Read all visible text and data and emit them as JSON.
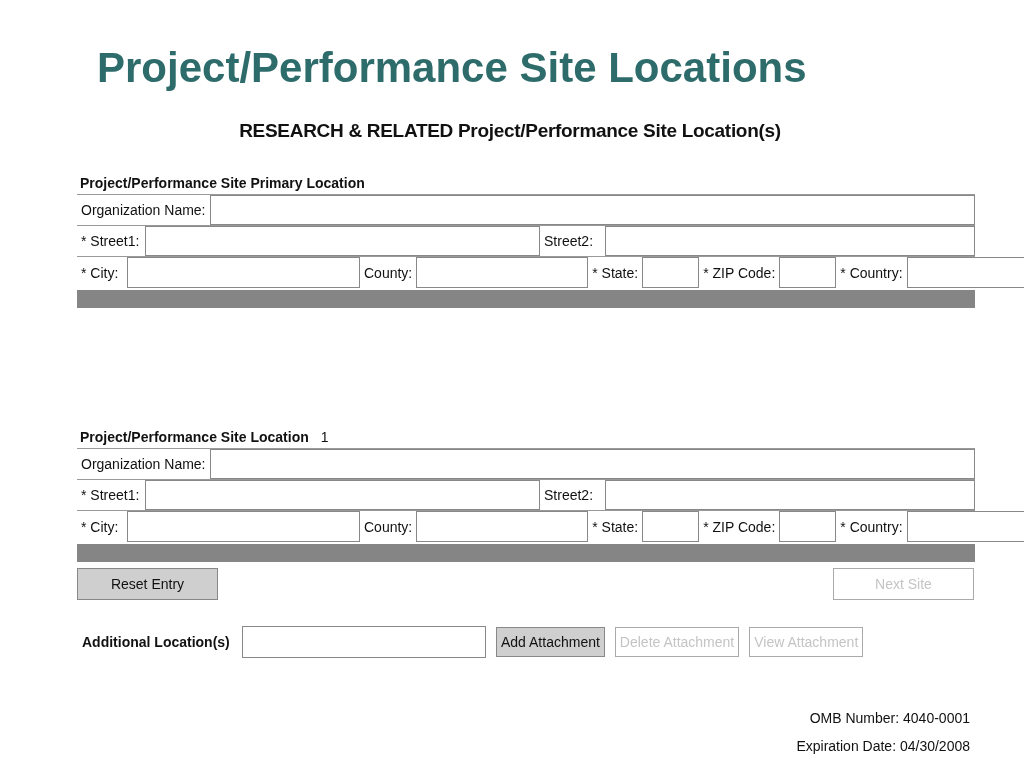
{
  "slide_title": "Project/Performance Site Locations",
  "form_title": "RESEARCH & RELATED Project/Performance Site Location(s)",
  "sections": [
    {
      "heading": "Project/Performance Site Primary Location",
      "rows": [
        [
          {
            "label": "Organization Name:"
          }
        ],
        [
          {
            "label": "* Street1:"
          },
          {
            "label": "Street2:"
          }
        ],
        [
          {
            "label": "* City:"
          },
          {
            "label": "County:"
          },
          {
            "label": "* State:"
          },
          {
            "label": "* ZIP Code:"
          },
          {
            "label": "* Country:"
          }
        ]
      ]
    },
    {
      "heading": "Project/Performance Site Location",
      "number": "1",
      "rows": [
        [
          {
            "label": "Organization Name:"
          }
        ],
        [
          {
            "label": "* Street1:"
          },
          {
            "label": "Street2:"
          }
        ],
        [
          {
            "label": "* City:"
          },
          {
            "label": "County:"
          },
          {
            "label": "* State:"
          },
          {
            "label": "* ZIP Code:"
          },
          {
            "label": "* Country:"
          }
        ]
      ]
    }
  ],
  "nav_buttons": [
    {
      "label": "Reset Entry",
      "disabled": false
    },
    {
      "label": "Next Site",
      "disabled": true
    }
  ],
  "additional": {
    "label": "Additional Location(s)",
    "buttons": [
      {
        "label": "Add Attachment",
        "disabled": false
      },
      {
        "label": "Delete Attachment",
        "disabled": true
      },
      {
        "label": "View Attachment",
        "disabled": true
      }
    ]
  },
  "footer": [
    "OMB Number: 4040-0001",
    "Expiration Date: 04/30/2008"
  ]
}
